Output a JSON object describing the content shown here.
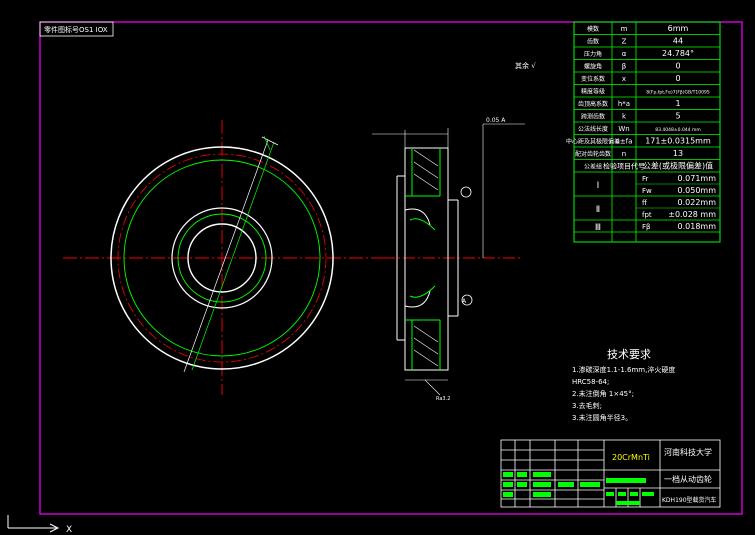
{
  "colors": {
    "background": "#000000",
    "frame": "#ff00ff",
    "drawing": "#ffffff",
    "table": "#00ff00",
    "center_line": "#ff0000",
    "text": "#ffffff"
  },
  "corner_tag": "零件图标号OS1 IOX",
  "roughness_note": "其余 √",
  "param_table": {
    "rows": [
      {
        "label": "模数",
        "sym": "m",
        "val": "6mm"
      },
      {
        "label": "齿数",
        "sym": "Z",
        "val": "44"
      },
      {
        "label": "压力角",
        "sym": "α",
        "val": "24.784°"
      },
      {
        "label": "螺旋角",
        "sym": "β",
        "val": "0"
      },
      {
        "label": "变位系数",
        "sym": "x",
        "val": "0"
      },
      {
        "label": "精度等级",
        "sym": "",
        "val": "8(Fp,fpt,Fα)7(Fβ)GB/T10095"
      },
      {
        "label": "齿顶高系数",
        "sym": "h*a",
        "val": "1"
      },
      {
        "label": "跨测齿数",
        "sym": "k",
        "val": "5"
      },
      {
        "label": "公法线长度",
        "sym": "Wn",
        "val": "83.4048±0.044 mm"
      },
      {
        "label": "中心距及其极限偏差",
        "sym": "a±fa",
        "val": "171±0.0315mm"
      },
      {
        "label": "配对齿轮齿数",
        "sym": "n",
        "val": "13"
      },
      {
        "label": "公差组",
        "sym": "检验项目代号",
        "val": "公差(或极限偏差)值"
      }
    ],
    "groups": [
      {
        "label": "Ⅰ",
        "items": [
          {
            "sym": "Fr",
            "val": "0.071mm"
          },
          {
            "sym": "Fw",
            "val": "0.050mm"
          }
        ]
      },
      {
        "label": "Ⅱ",
        "items": [
          {
            "sym": "ff",
            "val": "0.022mm"
          },
          {
            "sym": "fpt",
            "val": "±0.028 mm"
          }
        ]
      },
      {
        "label": "Ⅲ",
        "items": [
          {
            "sym": "Fβ",
            "val": "0.018mm"
          }
        ]
      }
    ]
  },
  "section_labels": {
    "datum_a": "A",
    "tolerance": "0.05 A",
    "chamfer": "Ra3.2"
  },
  "tech_req": {
    "title": "技术要求",
    "lines": [
      "1.渗碳深度1.1-1.6mm,淬火硬度",
      "HRC58-64;",
      "2.未注倒角 1×45°;",
      "3.去毛刺;",
      "3.未注圆角半径3。"
    ]
  },
  "title_block": {
    "material": "20CrMnTi",
    "school": "河南科技大学",
    "part_name": "一档从动齿轮",
    "project": "KDH190型载货汽车"
  },
  "ucs_label": "X"
}
